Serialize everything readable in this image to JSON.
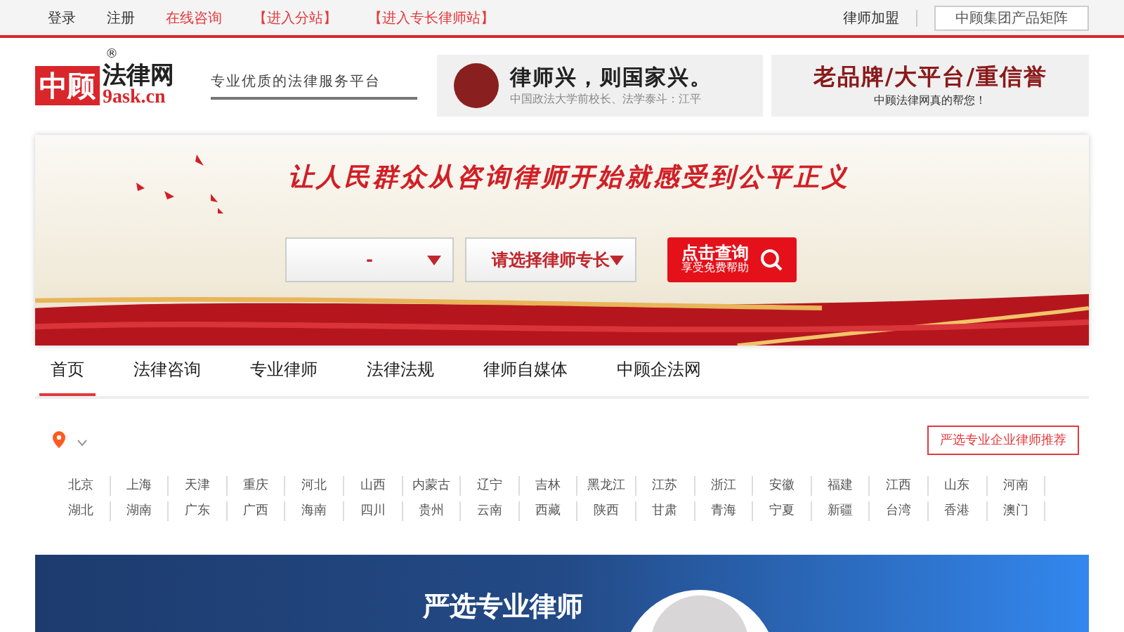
{
  "top_bar": {
    "links": [
      {
        "label": "登录",
        "kind": "plain"
      },
      {
        "label": "注册",
        "kind": "plain"
      },
      {
        "label": "在线咨询",
        "kind": "accent"
      },
      {
        "label": "【进入分站】",
        "kind": "accent"
      },
      {
        "label": "【进入专长律师站】",
        "kind": "accent"
      }
    ],
    "right_link": "律师加盟",
    "product_button": "中顾集团产品矩阵"
  },
  "header": {
    "logo_mark": "中顾",
    "logo_name": "法律网",
    "logo_registered": "®",
    "logo_domain": "9ask.cn",
    "slogan": "专业优质的法律服务平台",
    "ads": [
      {
        "kind": "portrait",
        "headline": "律师兴，则国家兴。",
        "caption": "中国政法大学前校长、法学泰斗：江平"
      },
      {
        "kind": "plain",
        "headline": "老品牌/大平台/重信誉",
        "caption": "中顾法律网真的帮您！"
      }
    ]
  },
  "hero": {
    "title": "让人民群众从咨询律师开始就感受到公平正义",
    "selects": [
      "-",
      "请选择律师专长"
    ],
    "search_button": {
      "label": "点击查询",
      "sublabel": "享受免费帮助"
    }
  },
  "nav": [
    {
      "label": "首页",
      "selected": true
    },
    {
      "label": "法律咨询",
      "selected": false
    },
    {
      "label": "专业律师",
      "selected": false
    },
    {
      "label": "法律法规",
      "selected": false
    },
    {
      "label": "律师自媒体",
      "selected": false
    },
    {
      "label": "中顾企法网",
      "selected": false
    }
  ],
  "location": {
    "recommend_button": "严选专业企业律师推荐"
  },
  "cities": [
    [
      "北京",
      "上海",
      "天津",
      "重庆",
      "河北",
      "山西",
      "内蒙古",
      "辽宁",
      "吉林",
      "黑龙江",
      "江苏",
      "浙江",
      "安徽",
      "福建",
      "江西",
      "山东",
      "河南"
    ],
    [
      "湖北",
      "湖南",
      "广东",
      "广西",
      "海南",
      "四川",
      "贵州",
      "云南",
      "西藏",
      "陕西",
      "甘肃",
      "青海",
      "宁夏",
      "新疆",
      "台湾",
      "香港",
      "澳门"
    ]
  ],
  "promo": {
    "title": "严选专业律师"
  }
}
